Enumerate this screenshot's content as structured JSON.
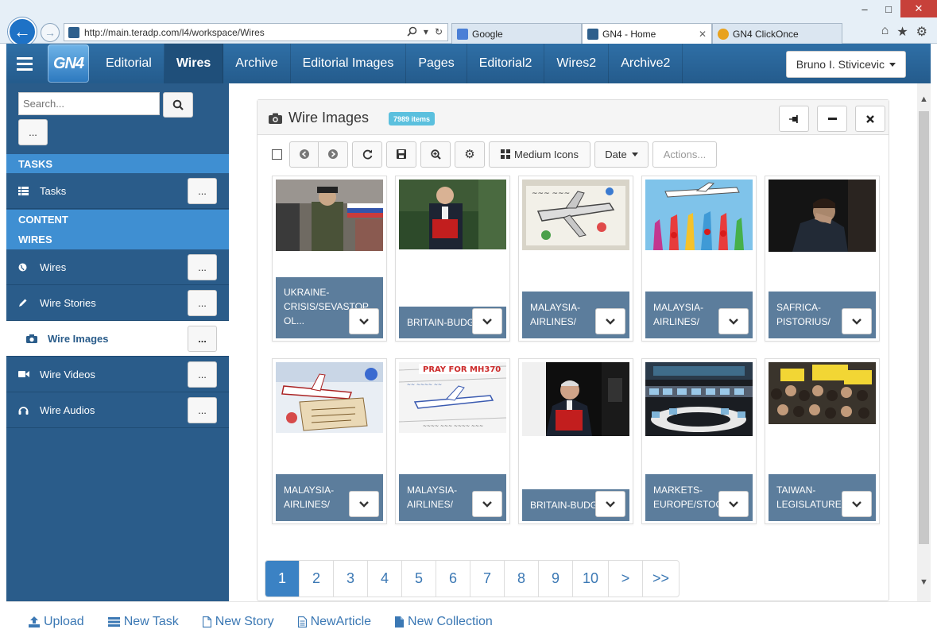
{
  "browser": {
    "window_controls": {
      "minimize": "–",
      "maximize": "□",
      "close": "✕"
    },
    "address": "http://main.teradp.com/l4/workspace/Wires",
    "tabs": [
      {
        "label": "Google",
        "active": false
      },
      {
        "label": "GN4 - Home",
        "active": true,
        "close": "✕"
      },
      {
        "label": "GN4 ClickOnce",
        "active": false
      }
    ]
  },
  "app": {
    "logo": "GN4",
    "nav": [
      "Editorial",
      "Wires",
      "Archive",
      "Editorial Images",
      "Pages",
      "Editorial2",
      "Wires2",
      "Archive2"
    ],
    "active_nav": "Wires",
    "user": "Bruno I. Stivicevic"
  },
  "sidebar": {
    "search_placeholder": "Search...",
    "more_label": "...",
    "tasks_header": "TASKS",
    "tasks_item": "Tasks",
    "content_header": "CONTENT",
    "wires_header": "WIRES",
    "items": [
      {
        "label": "Wires",
        "icon": "globe-icon"
      },
      {
        "label": "Wire Stories",
        "icon": "pencil-icon"
      },
      {
        "label": "Wire Images",
        "icon": "camera-icon",
        "active": true
      },
      {
        "label": "Wire Videos",
        "icon": "video-icon"
      },
      {
        "label": "Wire Audios",
        "icon": "headphones-icon"
      }
    ]
  },
  "panel": {
    "title": "Wire Images",
    "count_badge": "7989 items",
    "toolbar": {
      "view_label": "Medium Icons",
      "sort_label": "Date",
      "actions_label": "Actions..."
    },
    "cards": [
      {
        "caption_lines": [
          "UKRAINE-",
          "CRISIS/SEVASTOP",
          "OL..."
        ]
      },
      {
        "caption_lines": [
          "BRITAIN-BUDG"
        ]
      },
      {
        "caption_lines": [
          "MALAYSIA-",
          "AIRLINES/"
        ]
      },
      {
        "caption_lines": [
          "MALAYSIA-",
          "AIRLINES/"
        ]
      },
      {
        "caption_lines": [
          "SAFRICA-",
          "PISTORIUS/"
        ]
      },
      {
        "caption_lines": [
          "MALAYSIA-",
          "AIRLINES/"
        ]
      },
      {
        "caption_lines": [
          "MALAYSIA-",
          "AIRLINES/"
        ]
      },
      {
        "caption_lines": [
          "BRITAIN-BUDG"
        ]
      },
      {
        "caption_lines": [
          "MARKETS-",
          "EUROPE/STOC"
        ]
      },
      {
        "caption_lines": [
          "TAIWAN-",
          "LEGISLATURE"
        ]
      }
    ],
    "pagination": [
      "1",
      "2",
      "3",
      "4",
      "5",
      "6",
      "7",
      "8",
      "9",
      "10",
      ">",
      ">>"
    ],
    "active_page": "1"
  },
  "footer": {
    "links": [
      {
        "label": "Upload",
        "icon": "upload-icon"
      },
      {
        "label": "New Task",
        "icon": "list-icon"
      },
      {
        "label": "New Story",
        "icon": "file-icon"
      },
      {
        "label": "NewArticle",
        "icon": "article-icon"
      },
      {
        "label": "New Collection",
        "icon": "collection-icon"
      }
    ]
  },
  "colors": {
    "navbar": "#2a6496",
    "sidebar": "#2a5c8a",
    "section_header": "#3f8fd2",
    "caption_bg": "#5c7d9c",
    "badge": "#5bc0de",
    "link": "#3b78b4"
  }
}
